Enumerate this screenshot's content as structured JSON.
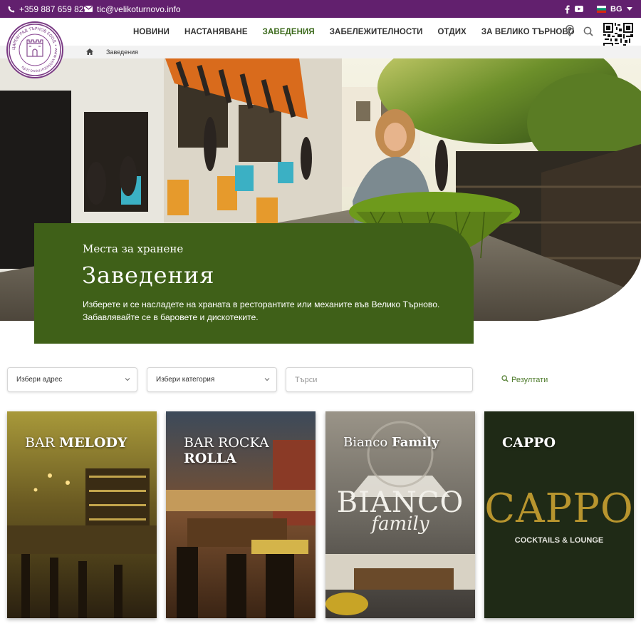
{
  "topbar": {
    "phone": "+359 887 659 829",
    "email": "tic@velikoturnovo.info",
    "language": "BG"
  },
  "nav": {
    "items": [
      {
        "label": "НОВИНИ"
      },
      {
        "label": "НАСТАНЯВАНЕ"
      },
      {
        "label": "ЗАВЕДЕНИЯ",
        "active": true
      },
      {
        "label": "ЗАБЕЛЕЖИТЕЛНОСТИ"
      },
      {
        "label": "ОТДИХ"
      },
      {
        "label": "ЗА ВЕЛИКО ТЪРНОВО"
      }
    ]
  },
  "breadcrumb": {
    "current": "Заведения"
  },
  "logo": {
    "text": "ЦАРЕВГРАД ТЪРНОВ ЕООД • www.velikoturnovo.info"
  },
  "hero": {
    "subtitle": "Места за хранене",
    "title": "Заведения",
    "description": "Изберете и се насладете на храната в ресторантите или механите във Велико Търново. Забавлявайте се в баровете и дискотеките."
  },
  "filters": {
    "address_placeholder": "Избери адрес",
    "category_placeholder": "Избери категория",
    "search_placeholder": "Търси",
    "results_label": "Резултати"
  },
  "cards": [
    {
      "title_light": "BAR ",
      "title_bold": "MELODY"
    },
    {
      "title_light": "BAR ROCKA",
      "title_bold": "ROLLA"
    },
    {
      "title_light": "Bianco ",
      "title_bold": "Family",
      "logo_main": "BIANCO",
      "logo_sub": "family"
    },
    {
      "title_light": "",
      "title_bold": "CAPPO",
      "logo_main": "CAPPO",
      "logo_sub": "COCKTAILS & LOUNGE"
    }
  ],
  "colors": {
    "topbar": "#62206e",
    "accent_green": "#3f6018",
    "nav_active": "#3c6a1c"
  }
}
